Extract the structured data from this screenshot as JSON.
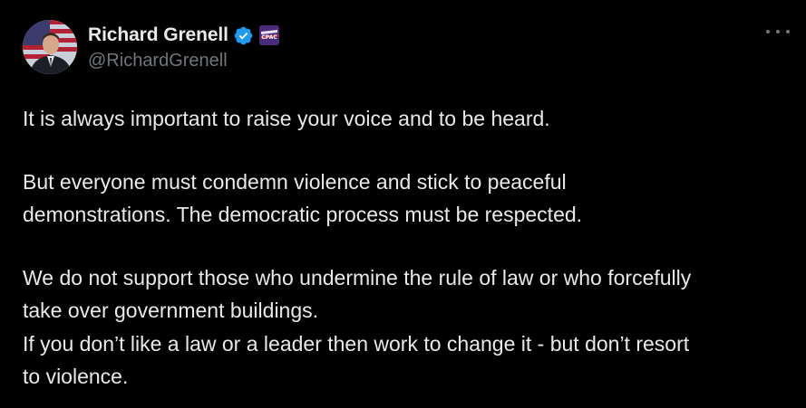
{
  "author": {
    "display_name": "Richard Grenell",
    "handle": "@RichardGrenell",
    "verified_icon": "verified-badge-icon",
    "affiliate_icon": "cpac-affiliate-icon"
  },
  "menu": {
    "more_icon": "more-options-icon"
  },
  "tweet": {
    "paragraph_1": "It is always important to raise your voice and to be heard.",
    "paragraph_2_line_1": "But everyone must condemn violence and stick to peaceful",
    "paragraph_2_line_2": "demonstrations. The democratic process must be respected.",
    "paragraph_3_line_1": "We do not support those who undermine the rule of law or who forcefully",
    "paragraph_3_line_2": "take over government buildings.",
    "paragraph_3_line_3": "If you don’t like a law or a leader then work to change it - but don’t resort",
    "paragraph_3_line_4": "to violence."
  },
  "colors": {
    "background": "#000000",
    "text": "#e7e9ea",
    "secondary_text": "#71767b",
    "verified_blue": "#1d9bf0"
  }
}
